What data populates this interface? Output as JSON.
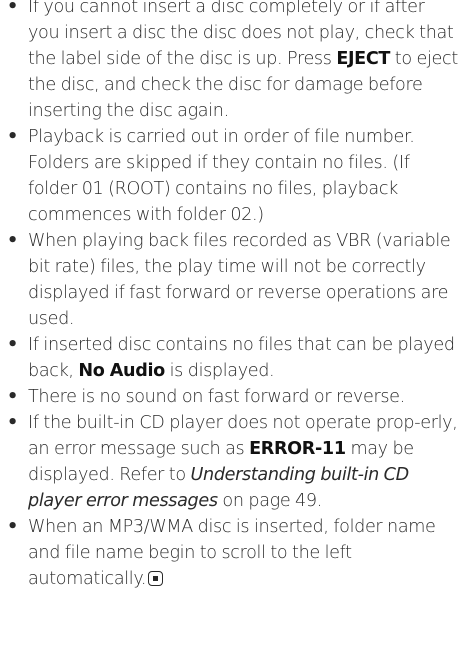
{
  "bullets": [
    {
      "parts": [
        {
          "text": "If you cannot insert a disc completely or if after you insert a disc the disc does not play, check that the label side of the disc is up. Press "
        },
        {
          "text": "EJECT",
          "style": "bold"
        },
        {
          "text": " to eject the disc, and check the disc for damage before inserting the disc again."
        }
      ]
    },
    {
      "parts": [
        {
          "text": "Playback is carried out in order of file number. Folders are skipped if they contain no files. (If folder 01 (ROOT) contains no files, playback commences with folder 02.)"
        }
      ]
    },
    {
      "parts": [
        {
          "text": "When playing back files recorded as VBR (variable bit rate) files, the play time will not be correctly displayed if fast forward or reverse operations are used."
        }
      ]
    },
    {
      "parts": [
        {
          "text": "If inserted disc contains no files that can be played back, "
        },
        {
          "text": "No Audio",
          "style": "bold"
        },
        {
          "text": " is displayed."
        }
      ]
    },
    {
      "parts": [
        {
          "text": "There is no sound on fast forward or reverse."
        }
      ]
    },
    {
      "parts": [
        {
          "text": "If the built-in CD player does not operate prop-erly, an error message such as "
        },
        {
          "text": "ERROR-11",
          "style": "bold"
        },
        {
          "text": " may be displayed. Refer to "
        },
        {
          "text": "Understanding built-in CD player error messages",
          "style": "italic"
        },
        {
          "text": " on page 49."
        }
      ]
    },
    {
      "parts": [
        {
          "text": "When an MP3/WMA disc is inserted, folder name and file name begin to scroll to the left automatically."
        }
      ],
      "end_mark_icon": "end-of-section-icon"
    }
  ],
  "bullet_glyph": "•"
}
